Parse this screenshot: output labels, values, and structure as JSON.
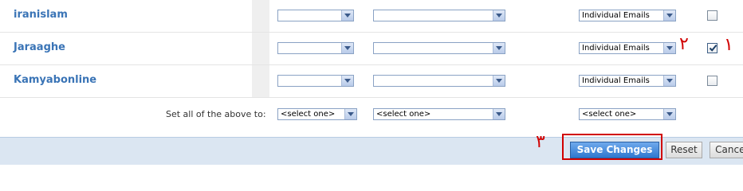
{
  "rows": [
    {
      "group": "iranislam",
      "select1": "",
      "select2": "",
      "delivery": "Individual Emails",
      "checked": false
    },
    {
      "group": "Jaraaghe",
      "select1": "",
      "select2": "",
      "delivery": "Individual Emails",
      "checked": true
    },
    {
      "group": "Kamyabonline",
      "select1": "",
      "select2": "",
      "delivery": "Individual Emails",
      "checked": false
    }
  ],
  "set_all": {
    "label": "Set all of the above to:",
    "select1": "<select one>",
    "select2": "<select one>",
    "select3": "<select one>"
  },
  "buttons": {
    "save": "Save Changes",
    "reset": "Reset",
    "cancel": "Cancel"
  },
  "annotations": {
    "one": "١",
    "two": "٢",
    "three": "٣"
  },
  "colors": {
    "link": "#3a74b6",
    "annotation_red": "#d10000",
    "save_button": "#2f78cf"
  }
}
